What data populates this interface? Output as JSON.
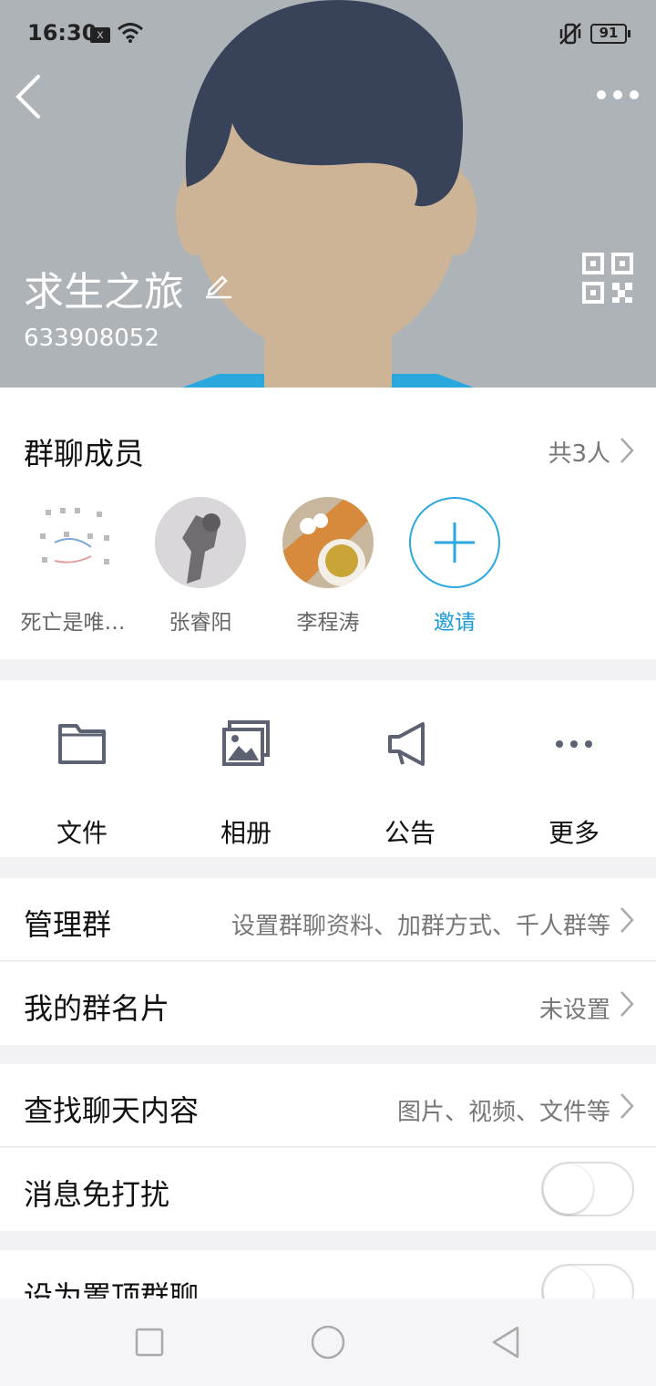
{
  "status": {
    "time": "16:30",
    "x_badge": "x",
    "battery": "91"
  },
  "header": {
    "group_name": "求生之旅",
    "group_id": "633908052"
  },
  "members": {
    "title": "群聊成员",
    "count": "共3人",
    "list": [
      {
        "name": "死亡是唯…"
      },
      {
        "name": "张睿阳"
      },
      {
        "name": "李程涛"
      }
    ],
    "invite_label": "邀请"
  },
  "tools": [
    {
      "label": "文件",
      "icon": "folder-icon"
    },
    {
      "label": "相册",
      "icon": "album-icon"
    },
    {
      "label": "公告",
      "icon": "megaphone-icon"
    },
    {
      "label": "更多",
      "icon": "more-dots-icon"
    }
  ],
  "rows": {
    "manage": {
      "title": "管理群",
      "value": "设置群聊资料、加群方式、千人群等"
    },
    "card": {
      "title": "我的群名片",
      "value": "未设置"
    },
    "search": {
      "title": "查找聊天内容",
      "value": "图片、视频、文件等"
    },
    "mute": {
      "title": "消息免打扰",
      "on": false
    },
    "pin": {
      "title": "设为置顶群聊",
      "on": false
    }
  },
  "colors": {
    "accent": "#2aa7dd",
    "header_bg": "#aeb3b8",
    "hair": "#38435a",
    "skin": "#cdb497"
  }
}
